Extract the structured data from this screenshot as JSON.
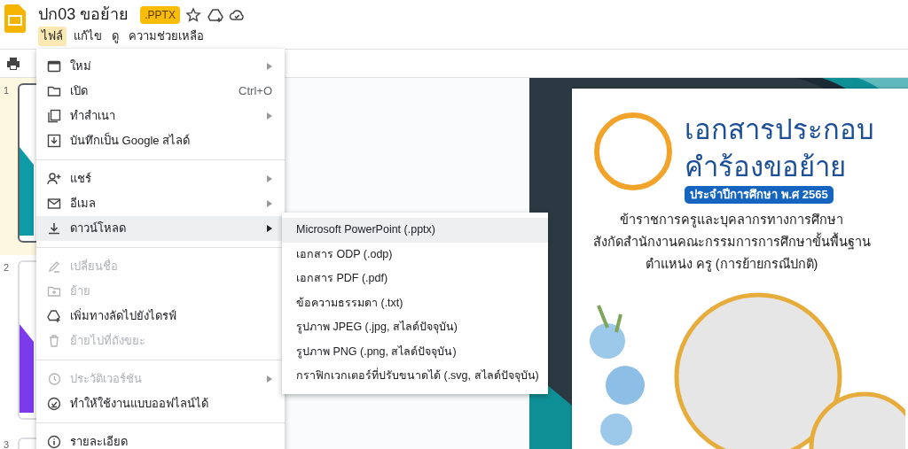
{
  "document": {
    "title": "ปก03 ขอย้าย",
    "format_badge": ".PPTX",
    "starred": false
  },
  "menubar": [
    {
      "label": "ไฟล์",
      "selected": true
    },
    {
      "label": "แก้ไข",
      "selected": false
    },
    {
      "label": "ดู",
      "selected": false
    },
    {
      "label": "ความช่วยเหลือ",
      "selected": false
    }
  ],
  "filmstrip": [
    {
      "number": "1",
      "selected": true,
      "color": "#0e9aa7"
    },
    {
      "number": "2",
      "selected": false,
      "color": "#7c3aed"
    },
    {
      "number": "3",
      "selected": false
    }
  ],
  "file_menu": [
    {
      "kind": "item",
      "label": "ใหม่",
      "submenu": true,
      "disabled": false,
      "selected": false
    },
    {
      "kind": "item",
      "label": "เปิด",
      "shortcut": "Ctrl+O",
      "submenu": false,
      "disabled": false,
      "selected": false
    },
    {
      "kind": "item",
      "label": "ทำสำเนา",
      "submenu": true,
      "disabled": false,
      "selected": false
    },
    {
      "kind": "item",
      "label": "บันทึกเป็น Google สไลด์",
      "submenu": false,
      "disabled": false,
      "selected": false
    },
    {
      "kind": "divider"
    },
    {
      "kind": "item",
      "label": "แชร์",
      "submenu": true,
      "disabled": false,
      "selected": false
    },
    {
      "kind": "item",
      "label": "อีเมล",
      "submenu": true,
      "disabled": false,
      "selected": false
    },
    {
      "kind": "item",
      "label": "ดาวน์โหลด",
      "submenu": true,
      "disabled": false,
      "selected": true
    },
    {
      "kind": "divider"
    },
    {
      "kind": "item",
      "label": "เปลี่ยนชื่อ",
      "submenu": false,
      "disabled": true,
      "selected": false
    },
    {
      "kind": "item",
      "label": "ย้าย",
      "submenu": false,
      "disabled": true,
      "selected": false
    },
    {
      "kind": "item",
      "label": "เพิ่มทางลัดไปยังไดรฟ์",
      "submenu": false,
      "disabled": false,
      "selected": false
    },
    {
      "kind": "item",
      "label": "ย้ายไปที่ถังขยะ",
      "submenu": false,
      "disabled": true,
      "selected": false
    },
    {
      "kind": "divider"
    },
    {
      "kind": "item",
      "label": "ประวัติเวอร์ชัน",
      "submenu": true,
      "disabled": true,
      "selected": false
    },
    {
      "kind": "item",
      "label": "ทำให้ใช้งานแบบออฟไลน์ได้",
      "submenu": false,
      "disabled": false,
      "selected": false
    },
    {
      "kind": "divider"
    },
    {
      "kind": "item",
      "label": "รายละเอียด",
      "submenu": false,
      "disabled": false,
      "selected": false
    }
  ],
  "download_submenu": [
    {
      "label": "Microsoft PowerPoint (.pptx)",
      "selected": true
    },
    {
      "label": "เอกสาร ODP (.odp)",
      "selected": false
    },
    {
      "label": "เอกสาร PDF (.pdf)",
      "selected": false
    },
    {
      "label": "ข้อความธรรมดา (.txt)",
      "selected": false
    },
    {
      "label": "รูปภาพ JPEG (.jpg, สไลด์ปัจจุบัน)",
      "selected": false
    },
    {
      "label": "รูปภาพ PNG (.png, สไลด์ปัจจุบัน)",
      "selected": false
    },
    {
      "label": "กราฟิกเวกเตอร์ที่ปรับขนาดได้ (.svg, สไลด์ปัจจุบัน)",
      "selected": false
    }
  ],
  "slide": {
    "title_lines": [
      "เอกสารประกอบ",
      "คำร้องขอย้าย"
    ],
    "year_badge": "ประจำปีการศึกษา พ.ศ 2565",
    "body_lines": [
      "ข้าราชการครูและบุคลากรทางการศึกษา",
      "สังกัดสำนักงานคณะกรรมการการศึกษาขั้นพื้นฐาน",
      "ตำแหน่ง ครู (การย้ายกรณีปกติ)"
    ]
  }
}
